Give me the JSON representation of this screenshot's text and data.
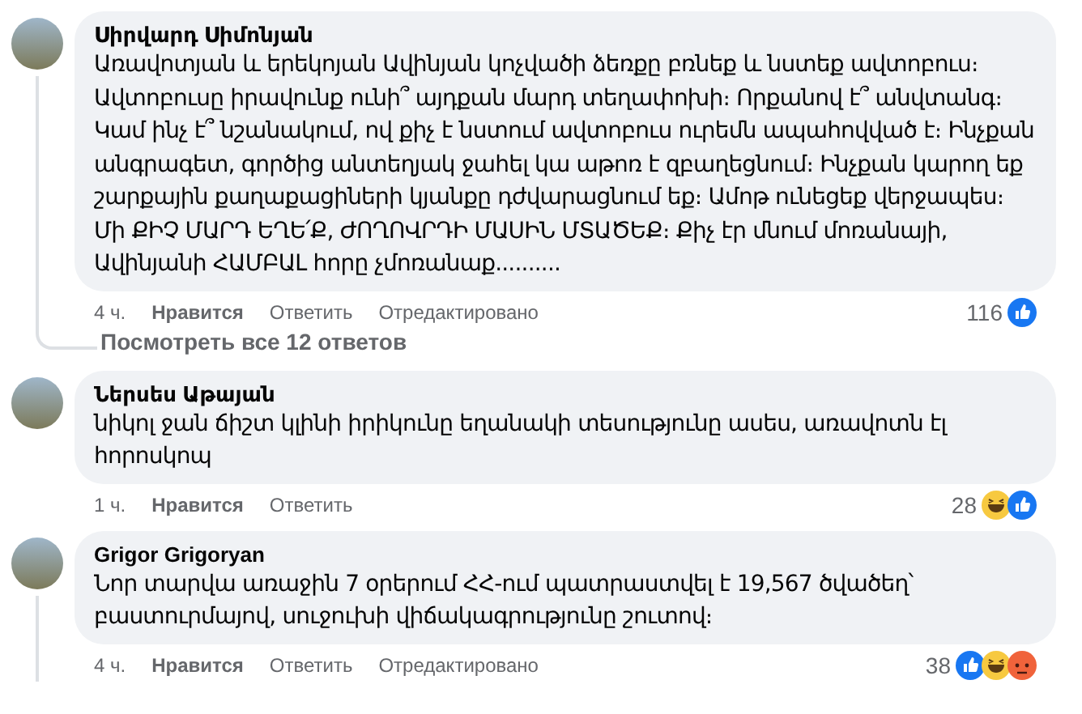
{
  "comments": [
    {
      "author": "Սիրվարդ Սիմոնյան",
      "text": "Առավոտյան և երեկոյան Ավինյան կոչվածի ձեռքը բռնեք և նստեք ավտոբուս։ Ավտոբուսը իրավունք ունի՞ այդքան մարդ տեղափոխի։ Որքանով է՞ անվտանգ։ Կամ ինչ է՞ նշանակում, ով քիչ է նստում ավտոբուս ուրեմն ապահովված է։ Ինչքան անգրագետ, գործից անտեղյակ ջահել կա աթոռ է զբաղեցնում։ Ինչքան կարող եք շարքային քաղաքացիների կյանքը դժվարացնում եք։ Ամոթ ունեցեք վերջապես։ Մի ՔԻՉ ՄԱՐԴ ԵՂԵ՛Ք, ԺՈՂՈՎՐԴԻ ՄԱՍԻՆ ՄՏԱԾԵՔ։ Քիչ էր մնում մոռանայի, Ավինյանի ՀԱՄԲԱԼ հորը չմոռանաք..........",
      "time": "4 ч.",
      "actions": [
        "Нравится",
        "Ответить",
        "Отредактировано"
      ],
      "count": "116",
      "reactions": [
        {
          "kind": "like"
        }
      ],
      "replies_link": "Посмотреть все 12 ответов",
      "thread_line": true
    },
    {
      "author": "Ներսես Աթայան",
      "text": "նիկոլ ջան ճիշտ կլինի իրիկունը եղանակի տեսությունը ասես, առավոտն էլ հորոսկոպ",
      "time": "1 ч.",
      "actions": [
        "Нравится",
        "Ответить"
      ],
      "count": "28",
      "reactions": [
        {
          "kind": "haha"
        },
        {
          "kind": "like"
        }
      ],
      "thread_line": false
    },
    {
      "author": "Grigor Grigoryan",
      "text": "Նոր տարվա առաջին 7 օրերում ՀՀ-ում պատրաստվել է 19,567 ծվածեղ՝ բաստուրմայով, սուջուխի վիճակագրությունը շուտով։",
      "time": "4 ч.",
      "actions": [
        "Нравится",
        "Ответить",
        "Отредактировано"
      ],
      "count": "38",
      "reactions": [
        {
          "kind": "like"
        },
        {
          "kind": "haha"
        },
        {
          "kind": "angry"
        }
      ],
      "thread_line": true
    }
  ]
}
